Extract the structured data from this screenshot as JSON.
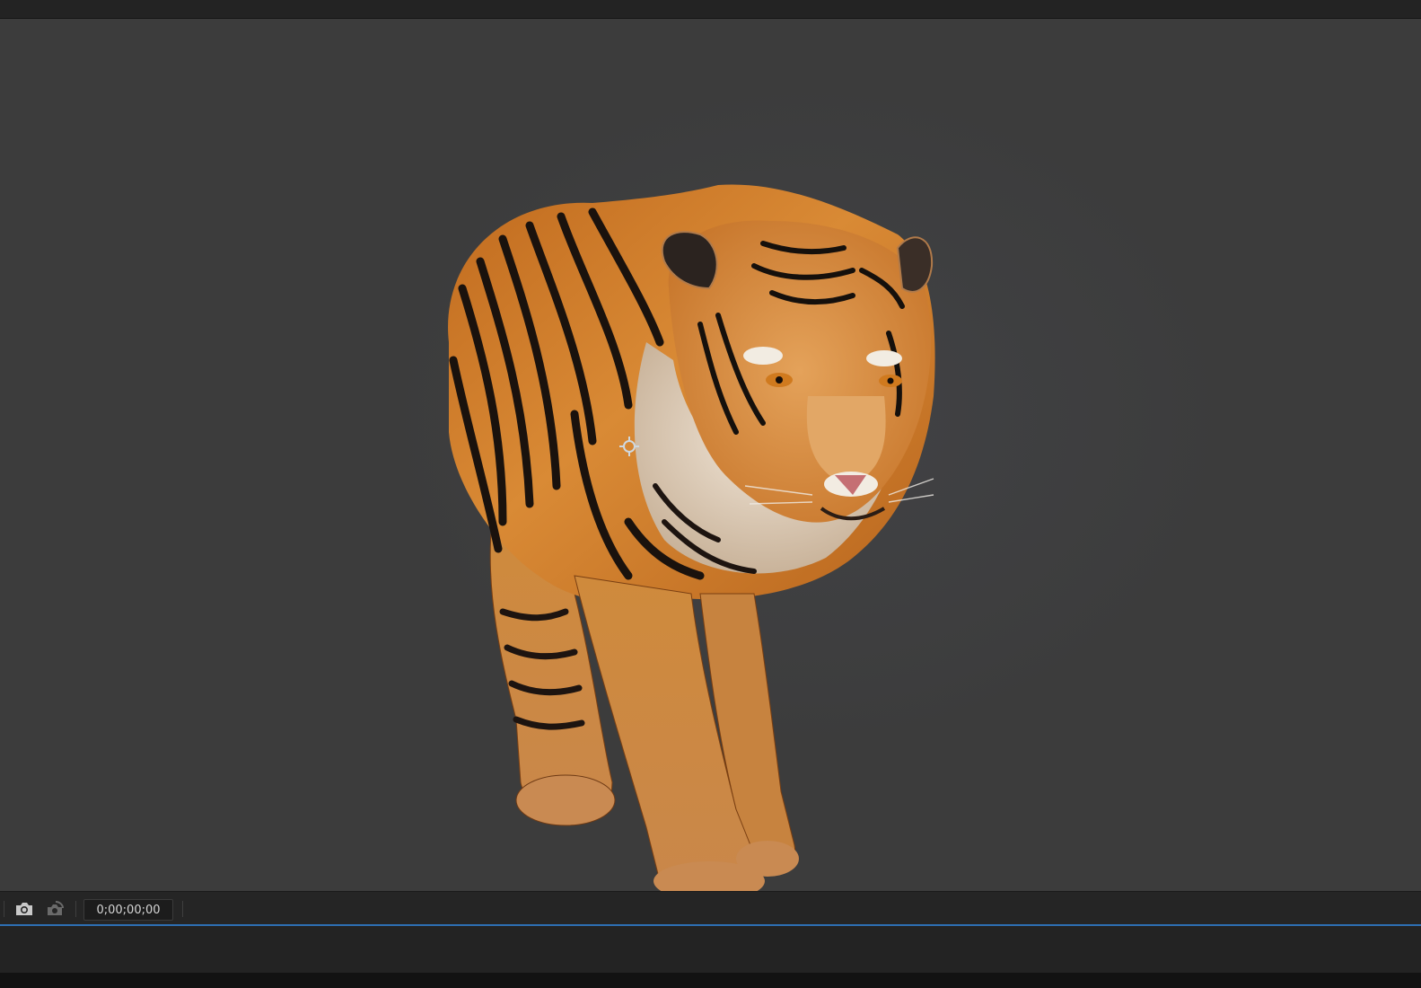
{
  "viewer": {
    "subject_icon": "tiger-3d-model",
    "anchor_icon": "anchor-point-icon"
  },
  "toolbar": {
    "snapshot_icon": "camera-icon",
    "show_snapshot_icon": "show-snapshot-icon",
    "timecode": "0;00;00;00"
  },
  "colors": {
    "viewport_bg": "#3c3c3c",
    "toolbar_bg": "#252525",
    "accent_line": "#2d6fb3"
  }
}
